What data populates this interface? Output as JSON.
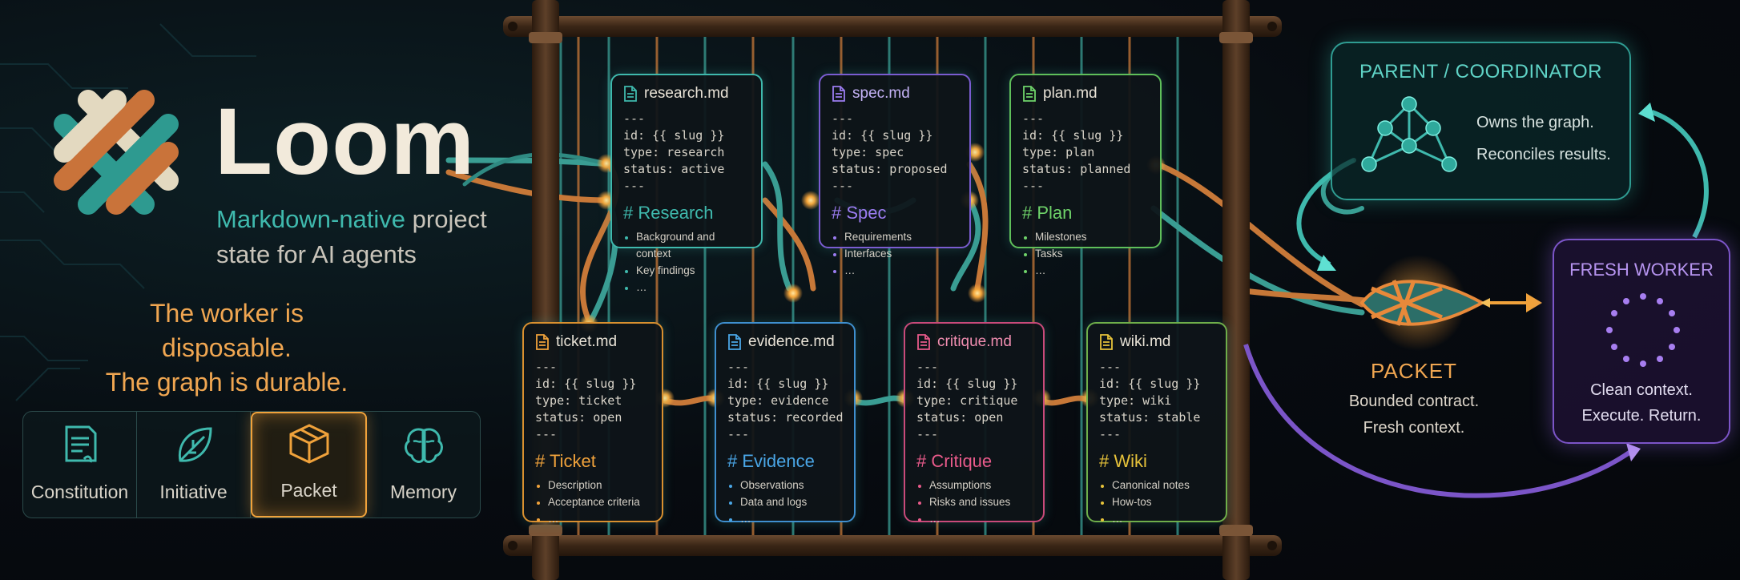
{
  "brand": {
    "title": "Loom",
    "subtitle_accent": "Markdown-native",
    "subtitle_rest": " project state for AI agents",
    "tagline_1": "The worker is disposable.",
    "tagline_2": "The graph is durable."
  },
  "pillars": [
    {
      "label": "Constitution",
      "icon": "document-scroll-icon",
      "active": false
    },
    {
      "label": "Initiative",
      "icon": "leaf-icon",
      "active": false
    },
    {
      "label": "Packet",
      "icon": "box-icon",
      "active": true
    },
    {
      "label": "Memory",
      "icon": "brain-icon",
      "active": false
    }
  ],
  "cards": {
    "research": {
      "file": "research.md",
      "fm": "---\nid: {{ slug }}\ntype: research\nstatus: active\n---",
      "heading": "# Research",
      "items": [
        "Background and context",
        "Key findings",
        "…"
      ],
      "color": "#3fb9ad"
    },
    "spec": {
      "file": "spec.md",
      "fm": "---\nid: {{ slug }}\ntype: spec\nstatus: proposed\n---",
      "heading": "# Spec",
      "items": [
        "Requirements",
        "Interfaces",
        "…"
      ],
      "color": "#9b7cf0"
    },
    "plan": {
      "file": "plan.md",
      "fm": "---\nid: {{ slug }}\ntype: plan\nstatus: planned\n---",
      "heading": "# Plan",
      "items": [
        "Milestones",
        "Tasks",
        "…"
      ],
      "color": "#6fd36a"
    },
    "ticket": {
      "file": "ticket.md",
      "fm": "---\nid: {{ slug }}\ntype: ticket\nstatus: open\n---",
      "heading": "# Ticket",
      "items": [
        "Description",
        "Acceptance criteria",
        "…"
      ],
      "color": "#f0a23b"
    },
    "evidence": {
      "file": "evidence.md",
      "fm": "---\nid: {{ slug }}\ntype: evidence\nstatus: recorded\n---",
      "heading": "# Evidence",
      "items": [
        "Observations",
        "Data and logs",
        "…"
      ],
      "color": "#4aa6e6"
    },
    "critique": {
      "file": "critique.md",
      "fm": "---\nid: {{ slug }}\ntype: critique\nstatus: open\n---",
      "heading": "# Critique",
      "items": [
        "Assumptions",
        "Risks and issues",
        "…"
      ],
      "color": "#e85a8a"
    },
    "wiki": {
      "file": "wiki.md",
      "fm": "---\nid: {{ slug }}\ntype: wiki\nstatus: stable\n---",
      "heading": "# Wiki",
      "items": [
        "Canonical notes",
        "How-tos",
        "…"
      ],
      "color": "#e6c23a"
    }
  },
  "coordinator": {
    "title": "PARENT / COORDINATOR",
    "line1": "Owns the graph.",
    "line2": "Reconciles results.",
    "icon": "graph-network-icon"
  },
  "packet": {
    "title": "PACKET",
    "line1": "Bounded contract.",
    "line2": "Fresh context."
  },
  "worker": {
    "title": "FRESH WORKER",
    "line1": "Clean context.",
    "line2": "Execute. Return.",
    "icon": "dotted-circle-icon"
  },
  "colors": {
    "teal": "#3fb9ad",
    "orange": "#e8893a",
    "purple": "#8b63d6",
    "wood": "#4a3220"
  }
}
